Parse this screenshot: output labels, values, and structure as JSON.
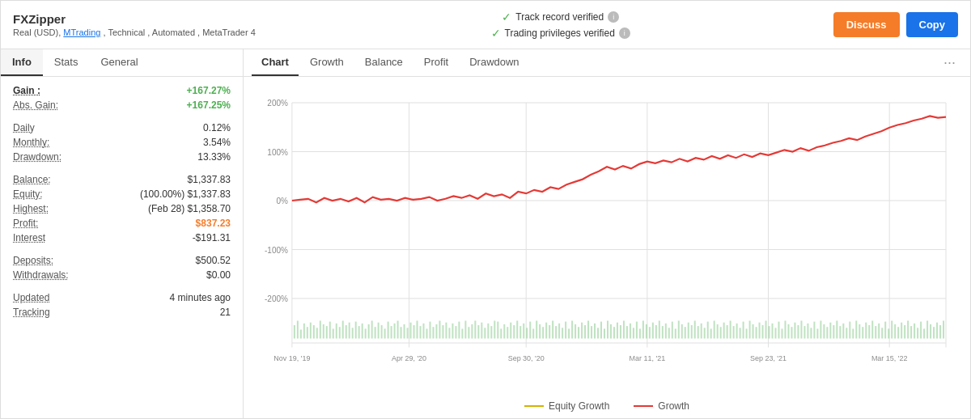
{
  "header": {
    "title": "FXZipper",
    "subtitle": "Real (USD), MTrading , Technical , Automated , MetaTrader 4",
    "subtitle_link": "MTrading",
    "verification1": "Track record verified",
    "verification2": "Trading privileges verified",
    "btn_discuss": "Discuss",
    "btn_copy": "Copy"
  },
  "left_panel": {
    "tabs": [
      "Info",
      "Stats",
      "General"
    ],
    "active_tab": "Info",
    "stats": {
      "gain_label": "Gain :",
      "gain_value": "+167.27%",
      "abs_gain_label": "Abs. Gain:",
      "abs_gain_value": "+167.25%",
      "daily_label": "Daily",
      "daily_value": "0.12%",
      "monthly_label": "Monthly:",
      "monthly_value": "3.54%",
      "drawdown_label": "Drawdown:",
      "drawdown_value": "13.33%",
      "balance_label": "Balance:",
      "balance_value": "$1,337.83",
      "equity_label": "Equity:",
      "equity_value": "(100.00%) $1,337.83",
      "highest_label": "Highest:",
      "highest_value": "(Feb 28) $1,358.70",
      "profit_label": "Profit:",
      "profit_value": "$837.23",
      "interest_label": "Interest",
      "interest_value": "-$191.31",
      "deposits_label": "Deposits:",
      "deposits_value": "$500.52",
      "withdrawals_label": "Withdrawals:",
      "withdrawals_value": "$0.00",
      "updated_label": "Updated",
      "updated_value": "4 minutes ago",
      "tracking_label": "Tracking",
      "tracking_value": "21"
    }
  },
  "right_panel": {
    "tabs": [
      "Chart",
      "Growth",
      "Balance",
      "Profit",
      "Drawdown"
    ],
    "active_tab": "Chart"
  },
  "chart": {
    "y_labels": [
      "200%",
      "100%",
      "0%",
      "-100%",
      "-200%"
    ],
    "x_labels": [
      "Nov 19, '19",
      "Apr 29, '20",
      "Sep 30, '20",
      "Mar 11, '21",
      "Sep 23, '21",
      "Mar 15, '22"
    ],
    "legend_equity": "Equity Growth",
    "legend_growth": "Growth"
  }
}
